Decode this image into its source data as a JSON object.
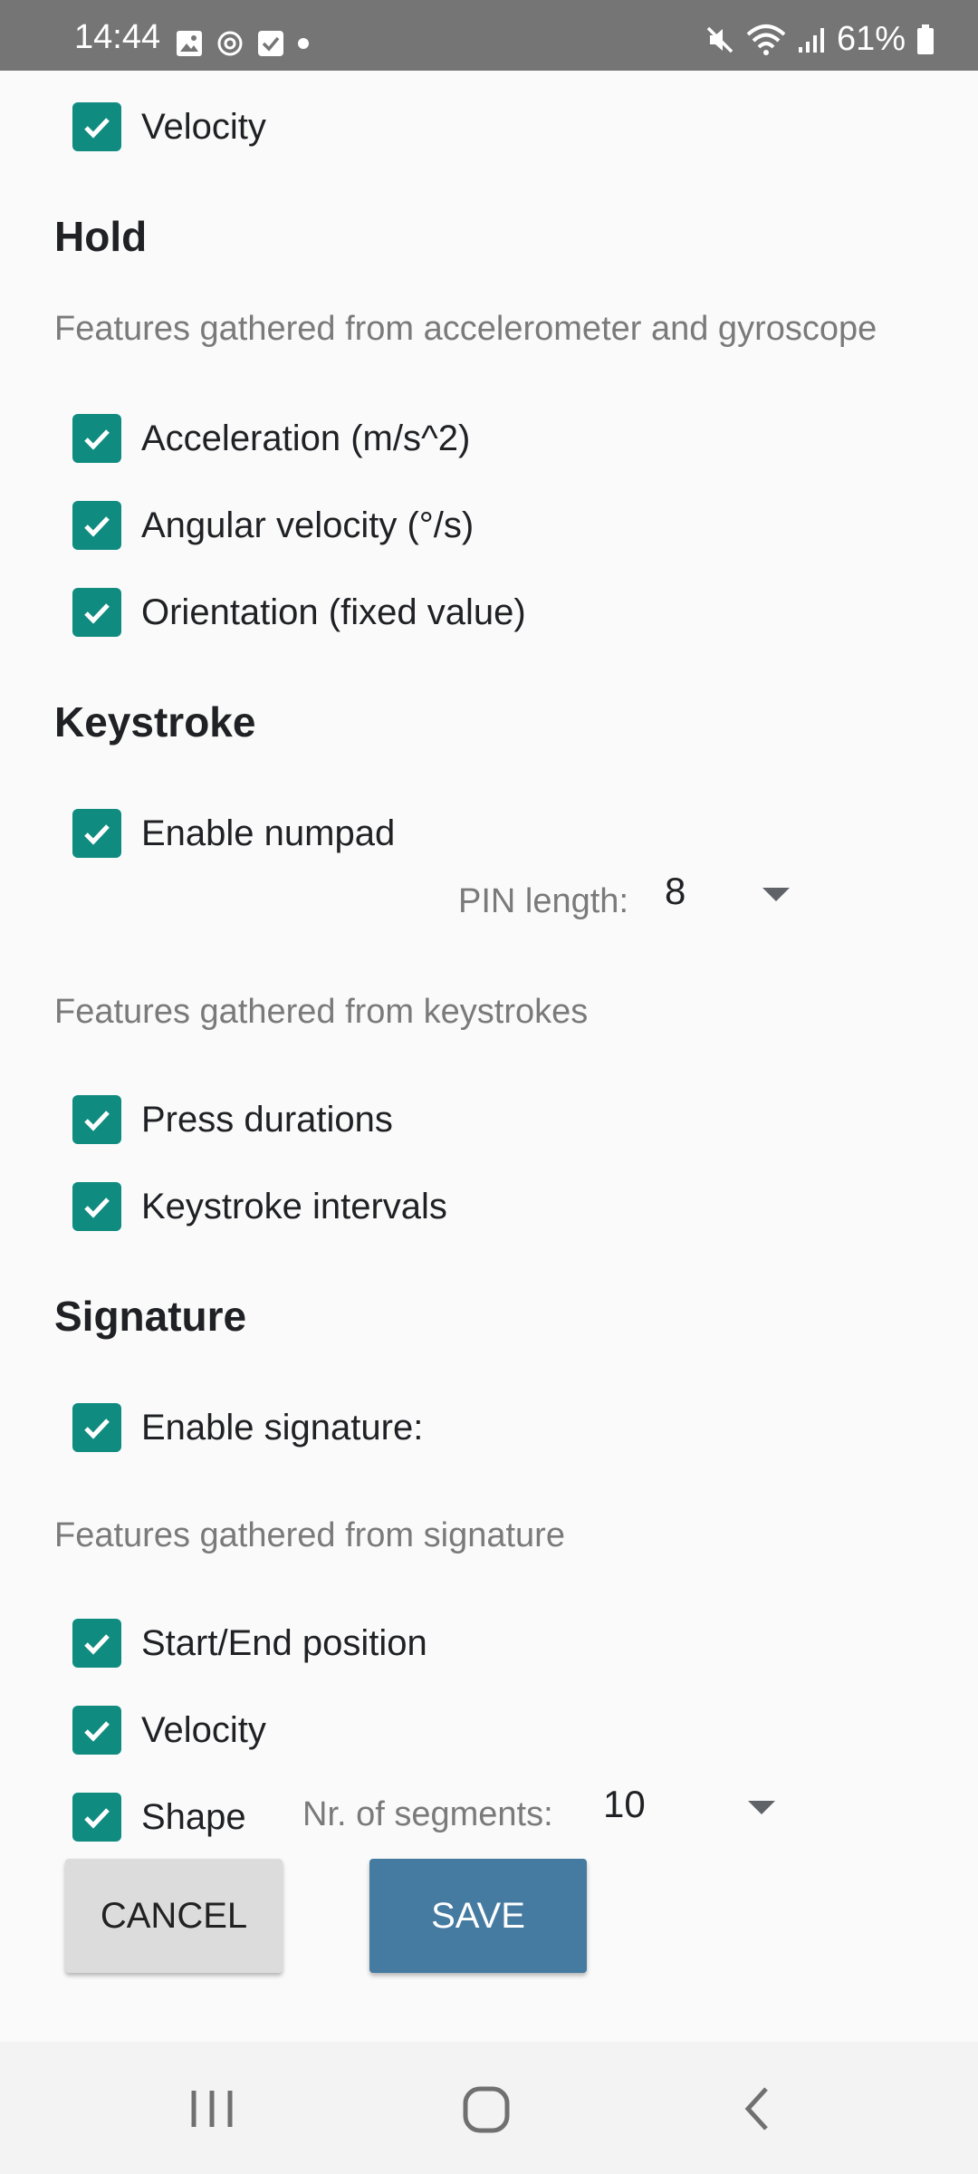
{
  "status_bar": {
    "time": "14:44",
    "battery": "61%",
    "icons": [
      "image-icon",
      "sync-icon",
      "checkbox-notification-icon",
      "dot-icon",
      "mute-icon",
      "wifi-icon",
      "signal-icon",
      "battery-icon"
    ]
  },
  "touch": {
    "velocity_label": "Velocity"
  },
  "hold": {
    "title": "Hold",
    "description": "Features gathered from accelerometer and gyroscope",
    "items": [
      {
        "label": "Acceleration (m/s^2)",
        "checked": true
      },
      {
        "label": "Angular velocity (°/s)",
        "checked": true
      },
      {
        "label": "Orientation (fixed value)",
        "checked": true
      }
    ]
  },
  "keystroke": {
    "title": "Keystroke",
    "enable_numpad_label": "Enable numpad",
    "pin_length_label": "PIN length:",
    "pin_length_value": "8",
    "description": "Features gathered from keystrokes",
    "items": [
      {
        "label": "Press durations",
        "checked": true
      },
      {
        "label": "Keystroke intervals",
        "checked": true
      }
    ]
  },
  "signature": {
    "title": "Signature",
    "enable_label": "Enable signature:",
    "description": "Features gathered from signature",
    "items": [
      {
        "label": "Start/End position",
        "checked": true
      },
      {
        "label": "Velocity",
        "checked": true
      },
      {
        "label": "Shape",
        "checked": true
      }
    ],
    "segments_label": "Nr. of segments:",
    "segments_value": "10"
  },
  "buttons": {
    "cancel": "CANCEL",
    "save": "SAVE"
  },
  "colors": {
    "checkbox": "#0f8b80",
    "save_button": "#467ba1",
    "status_bar": "#757575"
  }
}
